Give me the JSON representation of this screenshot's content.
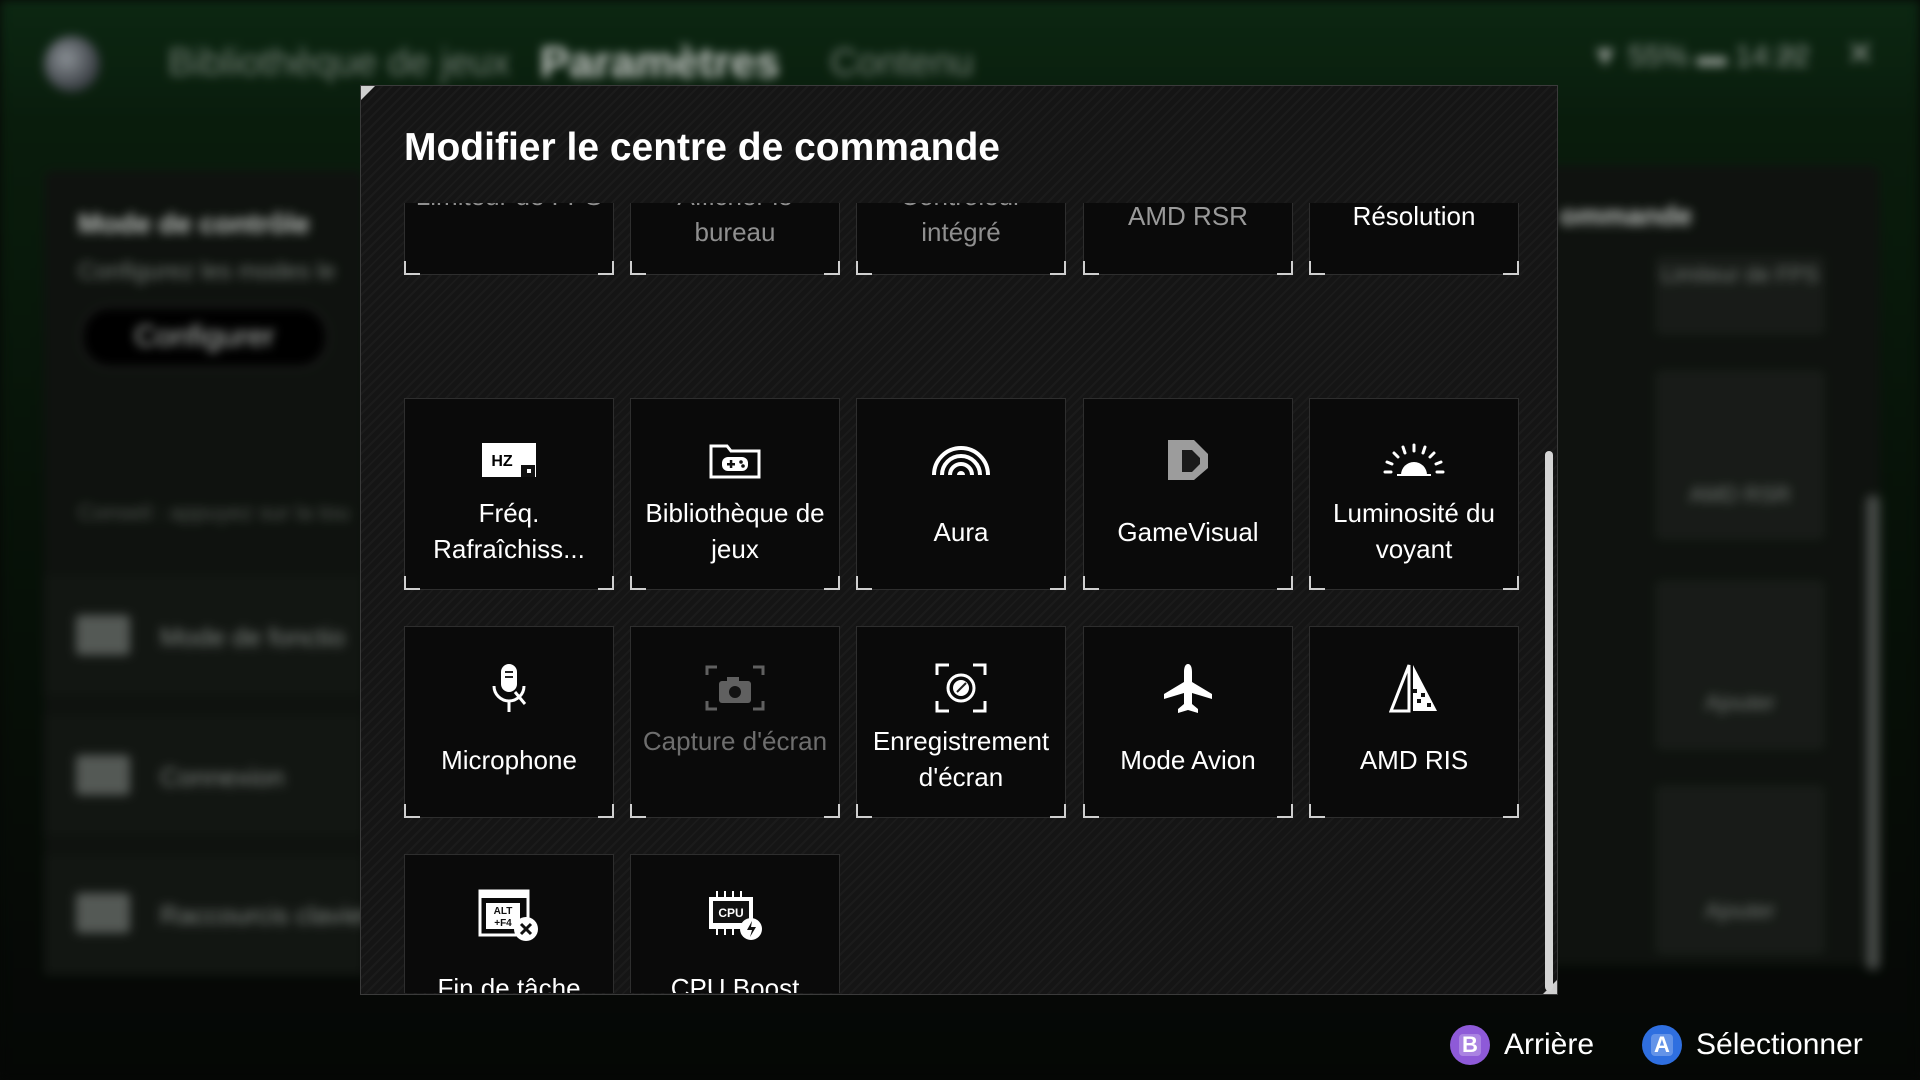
{
  "background": {
    "nav": [
      "Bibliothèque de jeux",
      "Paramètres",
      "Contenu"
    ],
    "status": {
      "battery": "55%",
      "time": "14:22"
    },
    "left_panel": {
      "title": "Mode de contrôle",
      "subtitle": "Configurez les modes le",
      "configure_label": "Configurer",
      "hint": "Conseil : appuyez sur la tou",
      "rows": [
        "Mode de fonctio",
        "Connexion",
        "Raccourcis clavier"
      ]
    },
    "right_panel": {
      "title": "ommande",
      "cards": [
        "Limiteur de FPS",
        "AMD RSR",
        "Ajouter",
        "Ajouter"
      ]
    }
  },
  "modal": {
    "title": "Modifier le centre de commande",
    "tiles": [
      {
        "label": "Limiteur de FPS",
        "icon": "fps-limiter-icon",
        "state": "partial"
      },
      {
        "label": "Afficher le bureau",
        "icon": "desktop-icon",
        "state": "partial"
      },
      {
        "label": "Contrôleur intégré",
        "icon": "controller-icon",
        "state": "partial"
      },
      {
        "label": "AMD RSR",
        "icon": "amd-rsr-icon",
        "state": "partial"
      },
      {
        "label": "Résolution",
        "icon": "resolution-icon",
        "state": "partial"
      },
      {
        "label": "Fréq. Rafraîchiss...",
        "icon": "refresh-rate-icon",
        "state": "normal"
      },
      {
        "label": "Bibliothèque de jeux",
        "icon": "game-library-icon",
        "state": "normal"
      },
      {
        "label": "Aura",
        "icon": "aura-icon",
        "state": "normal"
      },
      {
        "label": "GameVisual",
        "icon": "gamevisual-icon",
        "state": "normal"
      },
      {
        "label": "Luminosité du voyant",
        "icon": "light-brightness-icon",
        "state": "normal"
      },
      {
        "label": "Microphone",
        "icon": "microphone-icon",
        "state": "normal"
      },
      {
        "label": "Capture d'écran",
        "icon": "screenshot-icon",
        "state": "disabled"
      },
      {
        "label": "Enregistrement d'écran",
        "icon": "screen-record-icon",
        "state": "normal"
      },
      {
        "label": "Mode Avion",
        "icon": "airplane-icon",
        "state": "normal"
      },
      {
        "label": "AMD RIS",
        "icon": "amd-ris-icon",
        "state": "normal"
      },
      {
        "label": "Fin de tâche",
        "icon": "end-task-icon",
        "state": "normal"
      },
      {
        "label": "CPU Boost",
        "icon": "cpu-boost-icon",
        "state": "normal"
      }
    ]
  },
  "footer": {
    "back": {
      "key": "B",
      "label": "Arrière",
      "color": "#8e5ad8"
    },
    "select": {
      "key": "A",
      "label": "Sélectionner",
      "color": "#2f6fe0"
    }
  }
}
